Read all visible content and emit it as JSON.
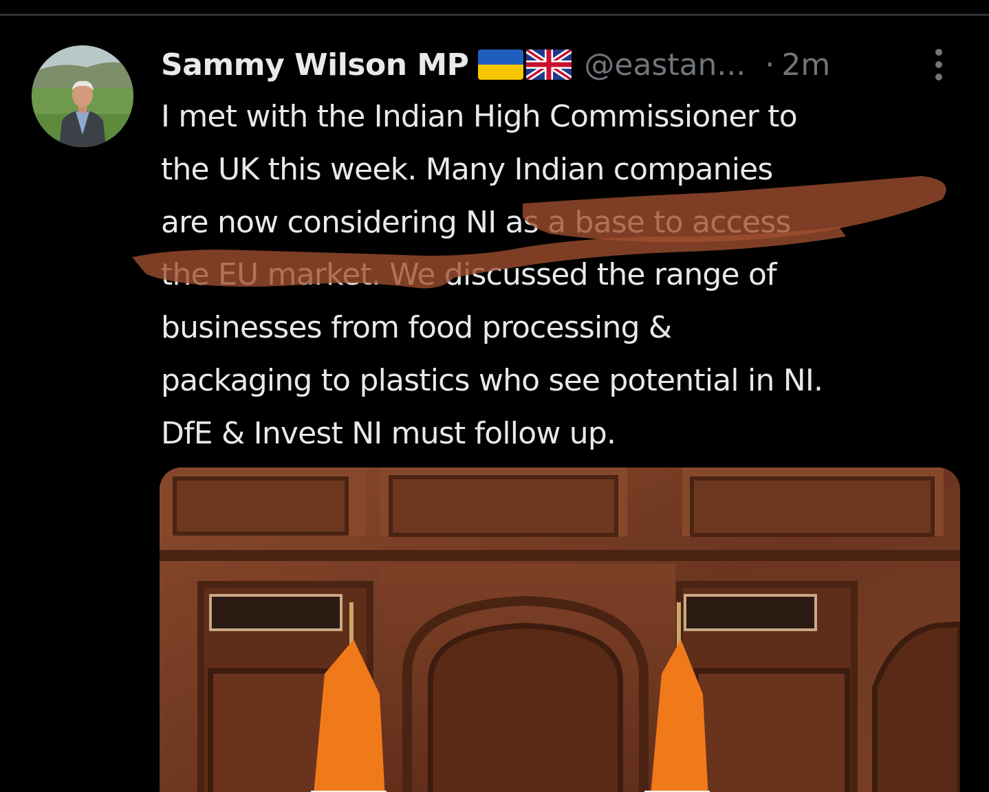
{
  "theme": {
    "background": "#000000",
    "text_primary": "#e7e9ea",
    "text_secondary": "#71767b",
    "divider": "#2f3336",
    "annotation_stroke": "#a0502f"
  },
  "tweet": {
    "author": {
      "display_name": "Sammy Wilson MP",
      "handle": "@eastan...",
      "flags": [
        "ukraine-flag-icon",
        "united-kingdom-flag-icon"
      ],
      "avatar": "avatar-photo"
    },
    "separator": "·",
    "timestamp": "2m",
    "more_icon": "more-vertical-icon",
    "text_lines": [
      "I met with the Indian High Commissioner to",
      "the UK this week. Many Indian companies",
      "are now considering NI as a base to access",
      "the EU market. We discussed the range of",
      "businesses from food processing &",
      "packaging to plastics who see potential in NI.",
      "DfE & Invest NI must follow up."
    ],
    "annotation": "hand-drawn-underline-highlight",
    "media": {
      "kind": "photo",
      "subject": "wood-panelled-room-with-indian-flags"
    }
  }
}
